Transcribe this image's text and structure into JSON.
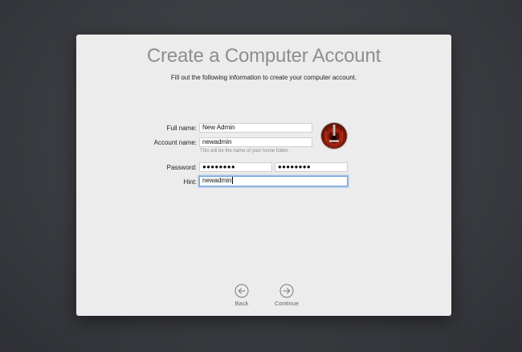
{
  "dialog": {
    "title": "Create a Computer Account",
    "subtitle": "Fill out the following information to create your computer account."
  },
  "form": {
    "full_name_label": "Full name:",
    "full_name_value": "New Admin",
    "account_name_label": "Account name:",
    "account_name_value": "newadmin",
    "account_name_help": "This will be the name of your home folder.",
    "password_label": "Password:",
    "password_value": "●●●●●●●●",
    "verify_value": "●●●●●●●●",
    "hint_label": "Hint:",
    "hint_value": "newadmin"
  },
  "navigation": {
    "back_label": "Back",
    "continue_label": "Continue"
  },
  "icons": {
    "avatar": "guitar-avatar-icon",
    "back": "back-arrow-icon",
    "continue": "continue-arrow-icon"
  },
  "colors": {
    "focus_ring": "#6ea1e0",
    "avatar_red": "#c0321b"
  }
}
